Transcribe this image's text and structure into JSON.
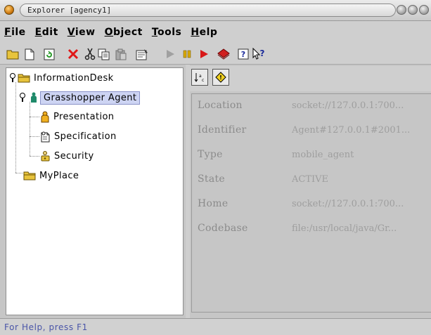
{
  "window": {
    "title": "Explorer [agency1]"
  },
  "menu": {
    "items": [
      {
        "name": "menu-file",
        "underline": "F",
        "rest": "ile"
      },
      {
        "name": "menu-edit",
        "underline": "E",
        "rest": "dit"
      },
      {
        "name": "menu-view",
        "underline": "V",
        "rest": "iew"
      },
      {
        "name": "menu-object",
        "underline": "O",
        "rest": "bject"
      },
      {
        "name": "menu-tools",
        "underline": "T",
        "rest": "ools"
      },
      {
        "name": "menu-help",
        "underline": "H",
        "rest": "elp"
      }
    ]
  },
  "toolbar": {
    "icons": [
      "open-folder-icon",
      "new-document-icon",
      "refresh-icon",
      "delete-icon",
      "cut-icon",
      "copy-icon",
      "paste-icon",
      "properties-icon",
      "play-icon",
      "pause-icon",
      "record-icon",
      "book-icon",
      "help-icon",
      "context-help-icon"
    ]
  },
  "tree": {
    "root": "InformationDesk",
    "agent": "Grasshopper Agent",
    "children": [
      "Presentation",
      "Specification",
      "Security"
    ],
    "other": "MyPlace"
  },
  "properties": {
    "rows": [
      {
        "key": "Location",
        "value": "socket://127.0.0.1:700..."
      },
      {
        "key": "Identifier",
        "value": "Agent#127.0.0.1#2001..."
      },
      {
        "key": "Type",
        "value": "mobile_agent"
      },
      {
        "key": "State",
        "value": "ACTIVE"
      },
      {
        "key": "Home",
        "value": "socket://127.0.0.1:700..."
      },
      {
        "key": "Codebase",
        "value": "file:/usr/local/java/Gr..."
      }
    ]
  },
  "status": {
    "text": "For Help, press F1"
  },
  "colors": {
    "selection": "#cdd4f3",
    "status_text": "#4a55a8",
    "folder": "#e8c43c"
  }
}
